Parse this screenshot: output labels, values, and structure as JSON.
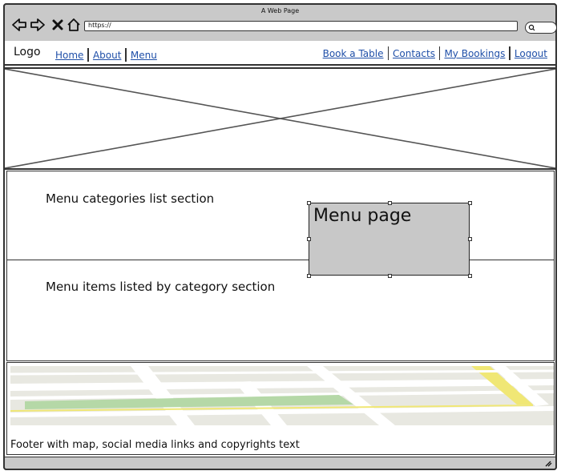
{
  "window": {
    "title": "A Web Page"
  },
  "browser": {
    "url": "https://",
    "icons": [
      "back-arrow-icon",
      "forward-arrow-icon",
      "close-icon",
      "home-icon",
      "search-icon"
    ]
  },
  "nav": {
    "logo": "Logo",
    "left_links": [
      "Home",
      "About",
      "Menu"
    ],
    "right_links": [
      "Book a Table",
      "Contacts",
      "My Bookings",
      "Logout"
    ],
    "link_color": "#1f4fa8"
  },
  "sections": {
    "categories": "Menu categories list section",
    "items": "Menu items listed by category section"
  },
  "callout": {
    "title": "Menu page",
    "fill": "#c8c8c8"
  },
  "footer": {
    "text": "Footer with map, social media links and copyrights text"
  }
}
